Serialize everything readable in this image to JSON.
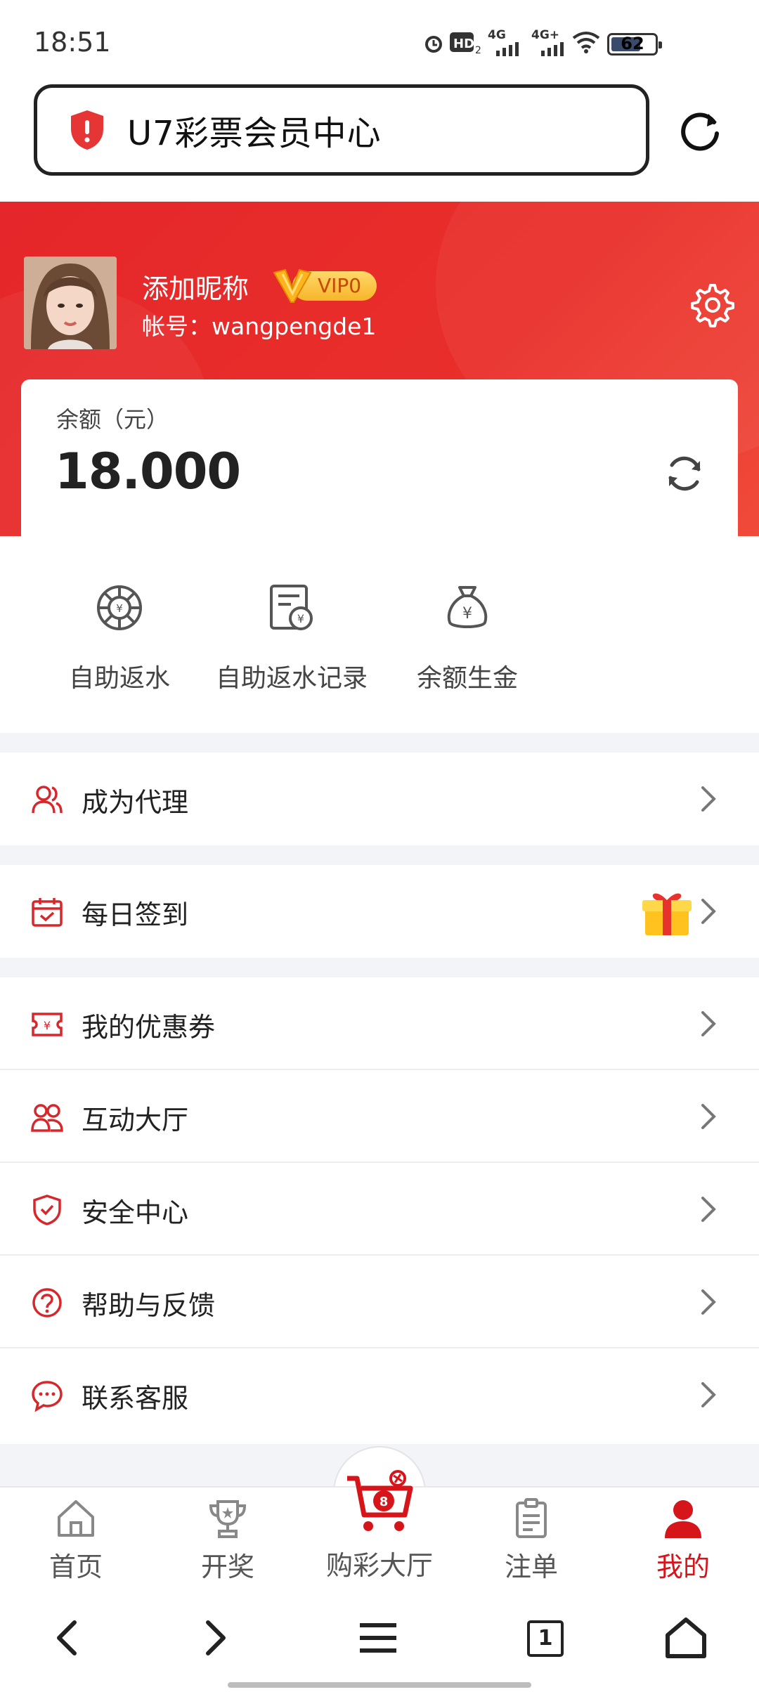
{
  "status_bar": {
    "time": "18:51",
    "network_1": "4G",
    "network_2": "4G+",
    "battery": "62"
  },
  "browser": {
    "title": "U7彩票会员中心",
    "tab_count": "1"
  },
  "profile": {
    "nickname": "添加昵称",
    "vip_level": "VIP0",
    "account": "帐号：wangpengde1"
  },
  "balance": {
    "label": "余额（元）",
    "value": "18.000"
  },
  "quick_actions": [
    {
      "label": "自助返水",
      "icon": "rebate-wheel-icon"
    },
    {
      "label": "自助返水记录",
      "icon": "rebate-record-icon"
    },
    {
      "label": "余额生金",
      "icon": "money-bag-icon"
    }
  ],
  "menu": [
    {
      "label": "成为代理",
      "icon": "agent-users-icon"
    },
    {
      "label": "每日签到",
      "icon": "calendar-check-icon"
    },
    {
      "label": "我的优惠券",
      "icon": "coupon-icon"
    },
    {
      "label": "互动大厅",
      "icon": "group-icon"
    },
    {
      "label": "安全中心",
      "icon": "shield-check-icon"
    },
    {
      "label": "帮助与反馈",
      "icon": "help-icon"
    },
    {
      "label": "联系客服",
      "icon": "chat-icon"
    }
  ],
  "tabbar": [
    {
      "label": "首页",
      "icon": "home-icon"
    },
    {
      "label": "开奖",
      "icon": "trophy-icon"
    },
    {
      "label": "购彩大厅",
      "icon": "cart-icon"
    },
    {
      "label": "注单",
      "icon": "clipboard-icon"
    },
    {
      "label": "我的",
      "icon": "user-icon",
      "active": true
    }
  ],
  "colors": {
    "brand_red": "#e5262a",
    "active_tab": "#d6151b",
    "icon_red": "#d6282c"
  }
}
